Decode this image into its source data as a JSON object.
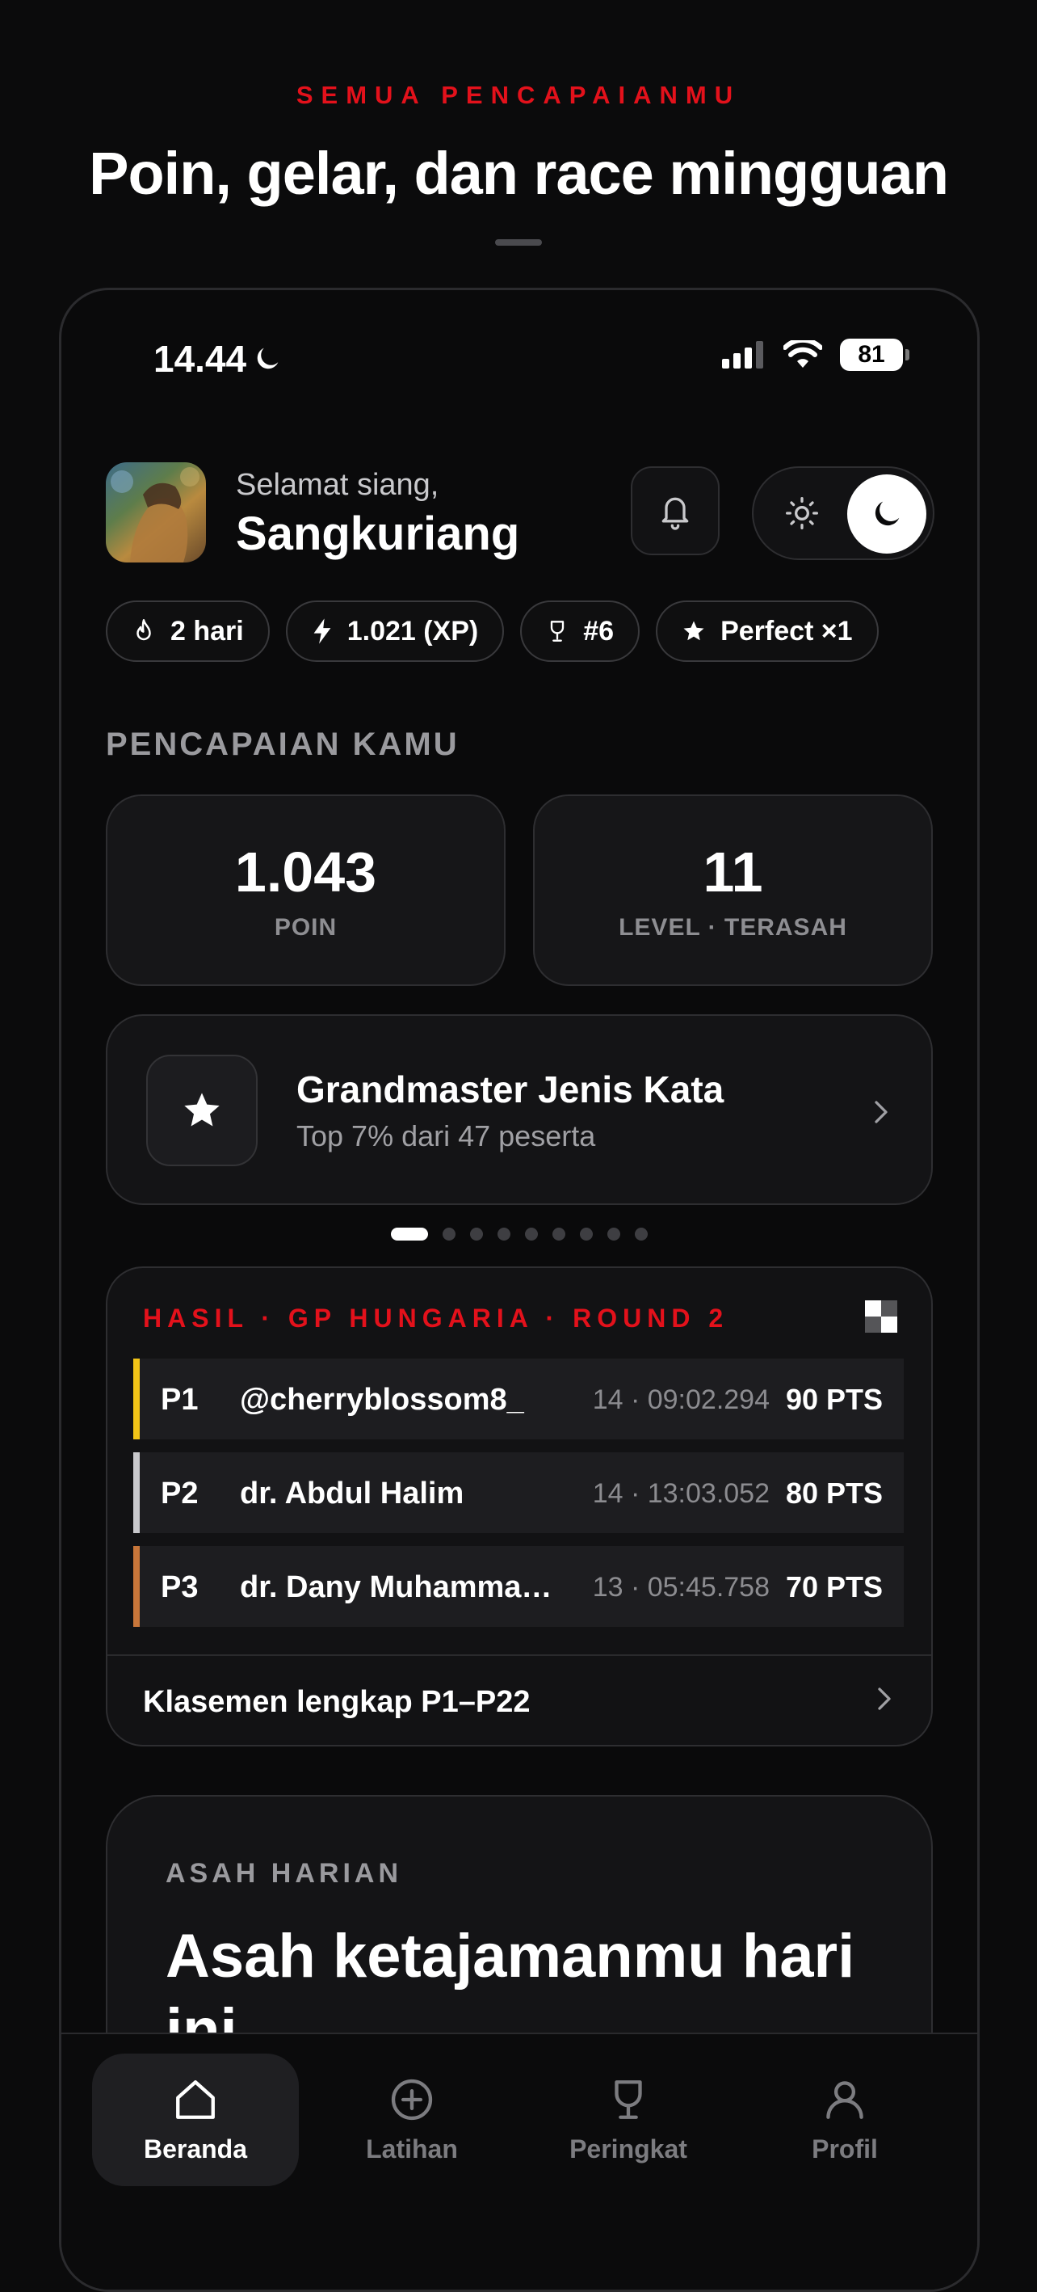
{
  "header": {
    "eyebrow": "SEMUA PENCAPAIANMU",
    "headline": "Poin, gelar, dan race mingguan"
  },
  "status_bar": {
    "time": "14.44",
    "battery": "81"
  },
  "profile": {
    "greeting": "Selamat siang,",
    "name": "Sangkuriang"
  },
  "chips": [
    {
      "icon": "flame-icon",
      "label": "2 hari"
    },
    {
      "icon": "bolt-icon",
      "label": "1.021 (XP)"
    },
    {
      "icon": "trophy-icon",
      "label": "#6"
    },
    {
      "icon": "star-icon",
      "label": "Perfect ×1"
    }
  ],
  "achievements": {
    "section_label": "PENCAPAIAN KAMU",
    "stats": [
      {
        "value": "1.043",
        "label": "POIN"
      },
      {
        "value": "11",
        "label": "LEVEL · TERASAH"
      }
    ],
    "title_card": {
      "title": "Grandmaster Jenis Kata",
      "subtitle": "Top 7% dari 47 peserta"
    },
    "pager": {
      "count": 9,
      "active": 0
    }
  },
  "results": {
    "heading": "HASIL · GP HUNGARIA · ROUND 2",
    "rows": [
      {
        "pos": "P1",
        "name": "@cherryblossom8_",
        "time": "14 · 09:02.294",
        "pts": "90 PTS",
        "color": "#f2c417"
      },
      {
        "pos": "P2",
        "name": "dr. Abdul Halim",
        "time": "14 · 13:03.052",
        "pts": "80 PTS",
        "color": "#c8c8cc"
      },
      {
        "pos": "P3",
        "name": "dr. Dany Muhammad…",
        "time": "13 · 05:45.758",
        "pts": "70 PTS",
        "color": "#c8763a"
      }
    ],
    "footer_link": "Klasemen lengkap P1–P22"
  },
  "daily": {
    "label": "ASAH HARIAN",
    "title": "Asah ketajamanmu hari ini"
  },
  "tabbar": [
    {
      "label": "Beranda",
      "icon": "home-icon",
      "active": true
    },
    {
      "label": "Latihan",
      "icon": "plus-circle-icon",
      "active": false
    },
    {
      "label": "Peringkat",
      "icon": "trophy-icon",
      "active": false
    },
    {
      "label": "Profil",
      "icon": "user-icon",
      "active": false
    }
  ],
  "colors": {
    "accent": "#e3111b",
    "background": "#0b0b0c",
    "card": "#161618"
  }
}
